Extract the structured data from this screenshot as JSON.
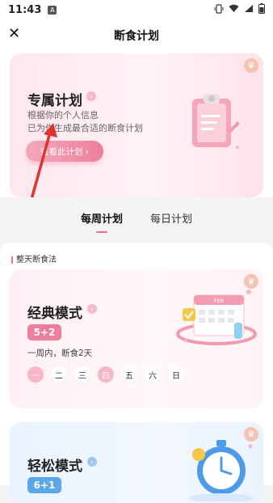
{
  "status_bar": {
    "time": "11:43",
    "notification_icon": "A",
    "icons": [
      "vibrate-icon",
      "wifi-icon",
      "signal-icon",
      "battery-icon"
    ]
  },
  "top_bar": {
    "close_icon": "✕",
    "title": "断食计划"
  },
  "hero": {
    "title": "专属计划",
    "desc_line1": "根据你的个人信息",
    "desc_line2": "已为你生成最合适的断食计划",
    "button_label": "查看此计划 ›"
  },
  "tabs": [
    {
      "label": "每周计划",
      "active": true
    },
    {
      "label": "每日计划",
      "active": false
    }
  ],
  "section": {
    "label": "整天断食法"
  },
  "classic_mode": {
    "title": "经典模式",
    "ratio": "5+2",
    "desc": "一周内，断食2天",
    "days": [
      {
        "label": "一",
        "fast": true
      },
      {
        "label": "二",
        "fast": false
      },
      {
        "label": "三",
        "fast": false
      },
      {
        "label": "四",
        "fast": true
      },
      {
        "label": "五",
        "fast": false
      },
      {
        "label": "六",
        "fast": false
      },
      {
        "label": "日",
        "fast": false
      }
    ],
    "calendar_label": "Feb"
  },
  "easy_mode": {
    "title": "轻松模式",
    "ratio": "6+1"
  },
  "colors": {
    "accent_pink": "#ee7f9c",
    "accent_blue": "#5aa7ea",
    "annotation_red": "#e0332f"
  }
}
